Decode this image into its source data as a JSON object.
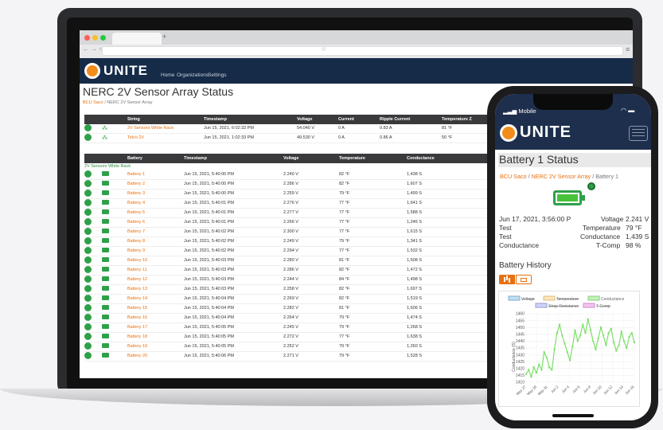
{
  "browser": {
    "new_tab_symbol": "+",
    "nav_symbols": "← → ○",
    "bookmark_symbol": "☆",
    "menu_symbol": "≡"
  },
  "app": {
    "logo_text": "UNITE",
    "nav": [
      "Home",
      "Organizations",
      "Settings"
    ]
  },
  "page": {
    "title": "NERC 2V Sensor Array Status",
    "crumb_link": "BCU Saco",
    "crumb_sep": "/",
    "crumb_current": "NERC 2V Sensor Array"
  },
  "string_table": {
    "headers": [
      "String",
      "Timestamp",
      "Voltage",
      "Current",
      "Ripple Current",
      "Temperature Z"
    ],
    "rows": [
      {
        "name": "2V Sensors White Rack",
        "timestamp": "Jun 15, 2021, 6:02:32 PM",
        "voltage": "54.040 V",
        "current": "0 A",
        "ripple": "0.83 A",
        "temp": "81 °F"
      },
      {
        "name": "Telco 2V",
        "timestamp": "Jun 15, 2021, 1:02:33 PM",
        "voltage": "49.530 V",
        "current": "0 A",
        "ripple": "0.86 A",
        "temp": "50 °F"
      }
    ]
  },
  "battery_table": {
    "headers": [
      "Battery",
      "Timestamp",
      "Voltage",
      "Temperature",
      "Conductance"
    ],
    "group_label": "2V Sensors White Rack",
    "rows": [
      {
        "name": "Battery 1",
        "timestamp": "Jun 15, 2021, 5:40:00 PM",
        "voltage": "2.240 V",
        "temp": "82 °F",
        "cond": "1,438 S"
      },
      {
        "name": "Battery 2",
        "timestamp": "Jun 15, 2021, 5:40:00 PM",
        "voltage": "2.286 V",
        "temp": "82 °F",
        "cond": "1,607 S"
      },
      {
        "name": "Battery 3",
        "timestamp": "Jun 15, 2021, 5:40:00 PM",
        "voltage": "2.259 V",
        "temp": "79 °F",
        "cond": "1,499 S"
      },
      {
        "name": "Battery 4",
        "timestamp": "Jun 15, 2021, 5:40:01 PM",
        "voltage": "2.276 V",
        "temp": "77 °F",
        "cond": "1,641 S"
      },
      {
        "name": "Battery 5",
        "timestamp": "Jun 15, 2021, 5:40:01 PM",
        "voltage": "2.277 V",
        "temp": "77 °F",
        "cond": "1,588 S"
      },
      {
        "name": "Battery 6",
        "timestamp": "Jun 15, 2021, 5:40:01 PM",
        "voltage": "2.266 V",
        "temp": "77 °F",
        "cond": "1,246 S"
      },
      {
        "name": "Battery 7",
        "timestamp": "Jun 15, 2021, 5:40:02 PM",
        "voltage": "2.300 V",
        "temp": "77 °F",
        "cond": "1,615 S"
      },
      {
        "name": "Battery 8",
        "timestamp": "Jun 15, 2021, 5:40:02 PM",
        "voltage": "2.249 V",
        "temp": "79 °F",
        "cond": "1,341 S"
      },
      {
        "name": "Battery 9",
        "timestamp": "Jun 15, 2021, 5:40:02 PM",
        "voltage": "2.294 V",
        "temp": "77 °F",
        "cond": "1,532 S"
      },
      {
        "name": "Battery 10",
        "timestamp": "Jun 15, 2021, 5:40:03 PM",
        "voltage": "2.280 V",
        "temp": "81 °F",
        "cond": "1,508 S"
      },
      {
        "name": "Battery 11",
        "timestamp": "Jun 15, 2021, 5:40:03 PM",
        "voltage": "2.286 V",
        "temp": "82 °F",
        "cond": "1,472 S"
      },
      {
        "name": "Battery 12",
        "timestamp": "Jun 15, 2021, 5:40:03 PM",
        "voltage": "2.244 V",
        "temp": "84 °F",
        "cond": "1,498 S"
      },
      {
        "name": "Battery 13",
        "timestamp": "Jun 15, 2021, 5:40:03 PM",
        "voltage": "2.258 V",
        "temp": "82 °F",
        "cond": "1,697 S"
      },
      {
        "name": "Battery 14",
        "timestamp": "Jun 15, 2021, 5:40:04 PM",
        "voltage": "2.269 V",
        "temp": "82 °F",
        "cond": "1,519 S"
      },
      {
        "name": "Battery 15",
        "timestamp": "Jun 15, 2021, 5:40:04 PM",
        "voltage": "2.282 V",
        "temp": "81 °F",
        "cond": "1,606 S"
      },
      {
        "name": "Battery 16",
        "timestamp": "Jun 15, 2021, 5:40:04 PM",
        "voltage": "2.264 V",
        "temp": "79 °F",
        "cond": "1,474 S"
      },
      {
        "name": "Battery 17",
        "timestamp": "Jun 15, 2021, 5:40:05 PM",
        "voltage": "2.245 V",
        "temp": "79 °F",
        "cond": "1,268 S"
      },
      {
        "name": "Battery 18",
        "timestamp": "Jun 15, 2021, 5:40:05 PM",
        "voltage": "2.272 V",
        "temp": "77 °F",
        "cond": "1,638 S"
      },
      {
        "name": "Battery 19",
        "timestamp": "Jun 15, 2021, 5:40:05 PM",
        "voltage": "2.252 V",
        "temp": "79 °F",
        "cond": "1,260 S"
      },
      {
        "name": "Battery 20",
        "timestamp": "Jun 15, 2021, 5:40:06 PM",
        "voltage": "2.271 V",
        "temp": "79 °F",
        "cond": "1,528 S"
      }
    ]
  },
  "phone": {
    "carrier": "Mobile",
    "logo_text": "UNITE",
    "title": "Battery 1 Status",
    "crumb": {
      "a": "BCU Saco",
      "b": "NERC 2V Sensor Array",
      "c": "Battery 1",
      "sep": "/"
    },
    "readings": {
      "timestamp": "Jun 17, 2021, 3:56:00 P",
      "voltage_label": "Voltage",
      "voltage": "2.241 V",
      "test1": "Test",
      "temp_label": "Temperature",
      "temp": "79 °F",
      "test2": "Test",
      "cond_label": "Conductance",
      "cond": "1,439 S",
      "cond_word": "Conductance",
      "tcomp_label": "T-Comp",
      "tcomp": "98 %"
    },
    "history_title": "Battery History",
    "legend": [
      "Voltage",
      "Temperature",
      "Conductance",
      "Strap Resistance",
      "T-Comp"
    ],
    "colors": {
      "accent": "#e8700f",
      "navy": "#1d2f4c",
      "green": "#2fa04a",
      "line": "#7ce06a"
    }
  },
  "chart_data": {
    "type": "line",
    "ylabel": "Conductance (S)",
    "ylim": [
      1410,
      1460
    ],
    "yticks": [
      1460,
      1455,
      1450,
      1445,
      1440,
      1435,
      1430,
      1425,
      1420,
      1415,
      1410
    ],
    "x_ticks": [
      "May 27",
      "May 29",
      "May 31",
      "Jun 2",
      "Jun 4",
      "Jun 6",
      "Jun 8",
      "Jun 10",
      "Jun 12",
      "Jun 14",
      "Jun 16"
    ],
    "series": [
      {
        "name": "Conductance",
        "values": [
          1416,
          1419,
          1414,
          1421,
          1417,
          1423,
          1419,
          1432,
          1428,
          1421,
          1419,
          1434,
          1446,
          1452,
          1444,
          1438,
          1432,
          1426,
          1436,
          1448,
          1440,
          1444,
          1452,
          1446,
          1456,
          1448,
          1440,
          1434,
          1442,
          1450,
          1444,
          1437,
          1446,
          1449,
          1439,
          1433,
          1437,
          1447,
          1440,
          1435,
          1443,
          1446,
          1439
        ]
      }
    ]
  }
}
